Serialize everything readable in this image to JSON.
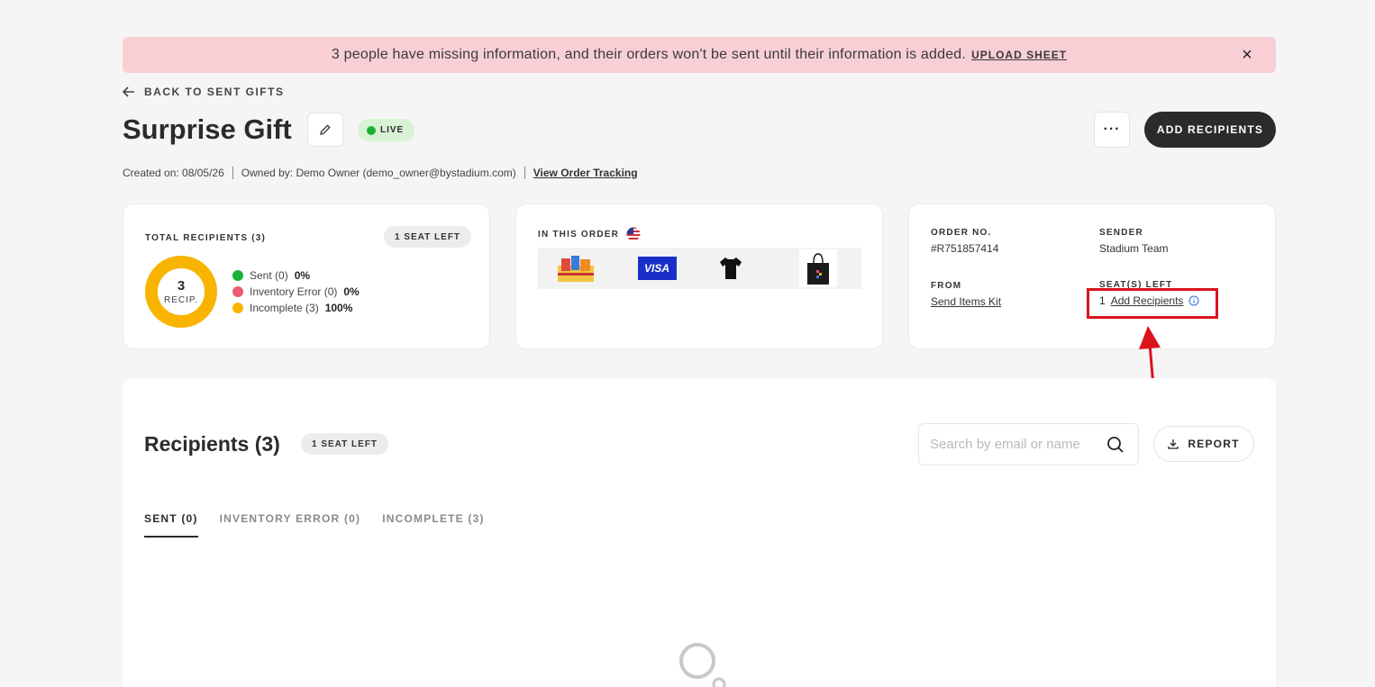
{
  "banner": {
    "message": "3 people have missing information, and their orders won't be sent until their information is added.",
    "link": "UPLOAD SHEET",
    "close": "×"
  },
  "back_link": "BACK TO SENT GIFTS",
  "title": "Surprise Gift",
  "status": "LIVE",
  "more_label": "···",
  "add_recipients_label": "ADD RECIPIENTS",
  "meta": {
    "created": "Created on: 08/05/26",
    "owner": "Owned by: Demo Owner (demo_owner@bystadium.com)",
    "tracking_link": "View Order Tracking"
  },
  "recipients_card": {
    "label": "TOTAL RECIPIENTS (3)",
    "seats_pill": "1 SEAT LEFT",
    "donut_number": "3",
    "donut_unit": "RECIP.",
    "legend": [
      {
        "label": "Sent (0)",
        "pct": "0%",
        "color": "#19b13a"
      },
      {
        "label": "Inventory Error (0)",
        "pct": "0%",
        "color": "#ec5a78"
      },
      {
        "label": "Incomplete (3)",
        "pct": "100%",
        "color": "#f8b400"
      }
    ]
  },
  "order_items": {
    "label": "IN THIS ORDER",
    "flag_icon": "us-flag-icon",
    "items": [
      "snacks-box",
      "visa-card",
      "black-tshirt",
      "black-tote-bag"
    ],
    "visa_text": "VISA"
  },
  "order_info": {
    "order_no_label": "ORDER NO.",
    "order_no": "#R751857414",
    "sender_label": "SENDER",
    "sender": "Stadium Team",
    "from_label": "FROM",
    "from": "Send Items Kit",
    "seats_label": "SEAT(S) LEFT",
    "seats_count": "1",
    "seats_link": "Add Recipients"
  },
  "recipients_panel": {
    "title": "Recipients (3)",
    "seats_pill": "1 SEAT LEFT",
    "search_placeholder": "Search by email or name",
    "report_label": "REPORT",
    "tabs": [
      {
        "label": "SENT (0)",
        "active": true
      },
      {
        "label": "INVENTORY ERROR (0)",
        "active": false
      },
      {
        "label": "INCOMPLETE (3)",
        "active": false
      }
    ]
  }
}
